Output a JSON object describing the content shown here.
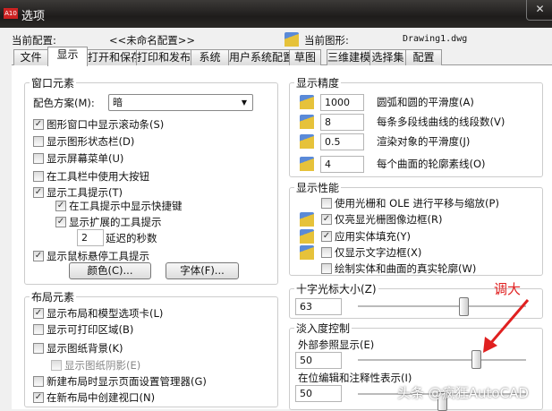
{
  "window": {
    "title": "选项",
    "close": "✕"
  },
  "header": {
    "profile_label": "当前配置:",
    "profile_value": "<<未命名配置>>",
    "drawing_label": "当前图形:",
    "drawing_value": "Drawing1.dwg"
  },
  "tabs": [
    "文件",
    "显示",
    "打开和保存",
    "打印和发布",
    "系统",
    "用户系统配置",
    "草图",
    "三维建模",
    "选择集",
    "配置"
  ],
  "window_elements": {
    "title": "窗口元素",
    "scheme_label": "配色方案(M):",
    "scheme_value": "暗",
    "items": [
      {
        "label": "图形窗口中显示滚动条(S)",
        "checked": true
      },
      {
        "label": "显示图形状态栏(D)",
        "checked": false
      },
      {
        "label": "显示屏幕菜单(U)",
        "checked": false
      },
      {
        "label": "在工具栏中使用大按钮",
        "checked": false
      },
      {
        "label": "显示工具提示(T)",
        "checked": true
      },
      {
        "label": "在工具提示中显示快捷键",
        "checked": true
      },
      {
        "label": "显示扩展的工具提示",
        "checked": true
      },
      {
        "label": "显示鼠标悬停工具提示",
        "checked": true
      }
    ],
    "delay_value": "2",
    "delay_label": "延迟的秒数",
    "colors_button": "颜色(C)...",
    "fonts_button": "字体(F)..."
  },
  "layout_elements": {
    "title": "布局元素",
    "items": [
      {
        "label": "显示布局和模型选项卡(L)",
        "checked": true
      },
      {
        "label": "显示可打印区域(B)",
        "checked": false
      },
      {
        "label": "显示图纸背景(K)",
        "checked": false
      },
      {
        "label": "显示图纸阴影(E)",
        "checked": false
      },
      {
        "label": "新建布局时显示页面设置管理器(G)",
        "checked": false
      },
      {
        "label": "在新布局中创建视口(N)",
        "checked": true
      }
    ]
  },
  "precision": {
    "title": "显示精度",
    "rows": [
      {
        "value": "1000",
        "label": "圆弧和圆的平滑度(A)"
      },
      {
        "value": "8",
        "label": "每条多段线曲线的线段数(V)"
      },
      {
        "value": "0.5",
        "label": "渲染对象的平滑度(J)"
      },
      {
        "value": "4",
        "label": "每个曲面的轮廓素线(O)"
      }
    ]
  },
  "performance": {
    "title": "显示性能",
    "items": [
      {
        "label": "使用光栅和 OLE 进行平移与缩放(P)",
        "checked": false
      },
      {
        "label": "仅亮显光栅图像边框(R)",
        "checked": true
      },
      {
        "label": "应用实体填充(Y)",
        "checked": true
      },
      {
        "label": "仅显示文字边框(X)",
        "checked": false
      },
      {
        "label": "绘制实体和曲面的真实轮廓(W)",
        "checked": false
      }
    ]
  },
  "crosshair": {
    "title": "十字光标大小(Z)",
    "value": "63",
    "slider_percent": 63
  },
  "fade": {
    "title": "淡入度控制",
    "xref_label": "外部参照显示(E)",
    "xref_value": "50",
    "xref_slider_percent": 70,
    "inplace_label": "在位编辑和注释性表示(I)",
    "inplace_value": "50",
    "inplace_slider_percent": 50
  },
  "annotation": {
    "text": "调大",
    "color": "#e02020"
  },
  "watermark": "头条 @疯狂AutoCAD"
}
